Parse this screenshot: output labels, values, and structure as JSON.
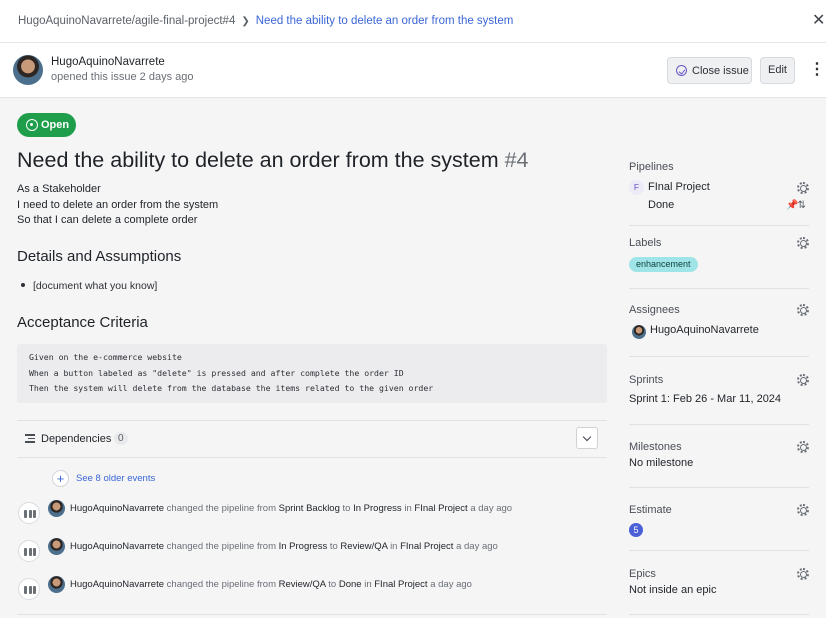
{
  "breadcrumb": {
    "repo": "HugoAquinoNavarrete/agile-final-project#4",
    "current": "Need the ability to delete an order from the system"
  },
  "header": {
    "author": "HugoAquinoNavarrete",
    "subtitle": "opened this issue 2 days ago",
    "close_label": "Close issue",
    "edit_label": "Edit"
  },
  "issue": {
    "status": "Open",
    "title": "Need the ability to delete an order from the system",
    "number": "#4",
    "story": [
      "As a Stakeholder",
      "I need to delete an order from the system",
      "So that I can delete a complete order"
    ],
    "details_heading": "Details and Assumptions",
    "details_items": [
      "[document what you know]"
    ],
    "criteria_heading": "Acceptance Criteria",
    "criteria_code": [
      "Given on the e-commerce website",
      "When a button labeled as \"delete\" is pressed and after complete the order ID",
      "Then the system will delete from the database the items related to the given order"
    ]
  },
  "dependencies": {
    "label": "Dependencies",
    "count": "0"
  },
  "timeline": {
    "older_label": "See 8 older events",
    "events": [
      {
        "user": "HugoAquinoNavarrete",
        "verb": "changed the pipeline from",
        "from": "Sprint Backlog",
        "to_word": "to",
        "to": "In Progress",
        "in_word": "in",
        "project": "FInal Project",
        "time": "a day ago"
      },
      {
        "user": "HugoAquinoNavarrete",
        "verb": "changed the pipeline from",
        "from": "In Progress",
        "to_word": "to",
        "to": "Review/QA",
        "in_word": "in",
        "project": "FInal Project",
        "time": "a day ago"
      },
      {
        "user": "HugoAquinoNavarrete",
        "verb": "changed the pipeline from",
        "from": "Review/QA",
        "to_word": "to",
        "to": "Done",
        "in_word": "in",
        "project": "FInal Project",
        "time": "a day ago"
      }
    ]
  },
  "sidebar": {
    "pipelines": {
      "heading": "Pipelines",
      "workspace_initial": "F",
      "workspace": "FInal Project",
      "status": "Done"
    },
    "labels": {
      "heading": "Labels",
      "items": [
        "enhancement"
      ]
    },
    "assignees": {
      "heading": "Assignees",
      "items": [
        "HugoAquinoNavarrete"
      ]
    },
    "sprints": {
      "heading": "Sprints",
      "value": "Sprint 1: Feb 26 - Mar 11, 2024"
    },
    "milestones": {
      "heading": "Milestones",
      "value": "No milestone"
    },
    "estimate": {
      "heading": "Estimate",
      "value": "5"
    },
    "epics": {
      "heading": "Epics",
      "value": "Not inside an epic"
    }
  },
  "colors": {
    "open_green": "#1e9e4a",
    "link_blue": "#3a66d6",
    "label_teal": "#9fe4e6",
    "estimate_blue": "#4a5fd8"
  }
}
